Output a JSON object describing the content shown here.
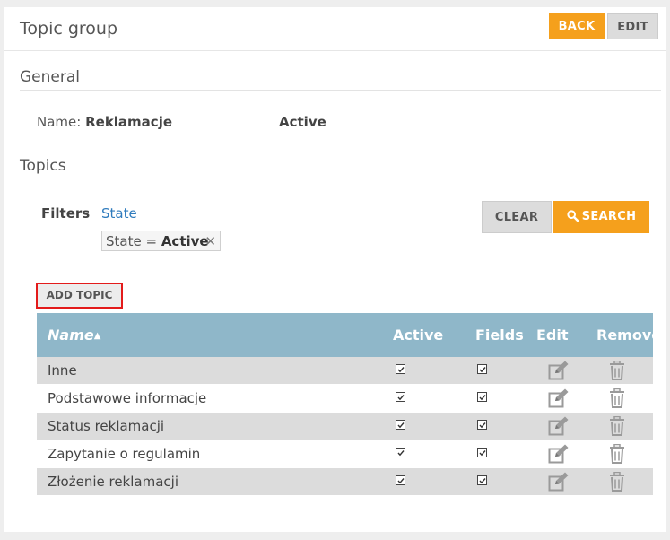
{
  "header": {
    "title": "Topic group",
    "back_label": "BACK",
    "edit_label": "EDIT"
  },
  "general": {
    "title": "General",
    "name_label": "Name:",
    "name_value": "Reklamacje",
    "state_value": "Active"
  },
  "topics": {
    "title": "Topics",
    "filters_label": "Filters",
    "filter_state_link": "State",
    "chip_prefix": "State = ",
    "chip_value": "Active",
    "chip_close": "✕",
    "clear_label": "CLEAR",
    "search_label": "SEARCH",
    "add_topic_label": "ADD TOPIC"
  },
  "table": {
    "columns": {
      "name": "Name",
      "sort_arrow": "▲",
      "active": "Active",
      "fields": "Fields",
      "edit": "Edit",
      "remove": "Remove"
    },
    "rows": [
      {
        "name": "Inne",
        "active": true,
        "fields": true
      },
      {
        "name": "Podstawowe informacje",
        "active": true,
        "fields": true
      },
      {
        "name": "Status reklamacji",
        "active": true,
        "fields": true
      },
      {
        "name": "Zapytanie o regulamin",
        "active": true,
        "fields": true
      },
      {
        "name": "Złożenie reklamacji",
        "active": true,
        "fields": true
      }
    ]
  },
  "icons": {
    "search": "search-icon",
    "checkbox": "checkbox-checked-icon",
    "edit": "edit-icon",
    "remove": "trash-icon",
    "close": "close-icon"
  },
  "colors": {
    "accent": "#f5a01c",
    "table_header": "#8fb7c9",
    "link": "#2f7bbd",
    "highlight_border": "#e31b1b"
  }
}
